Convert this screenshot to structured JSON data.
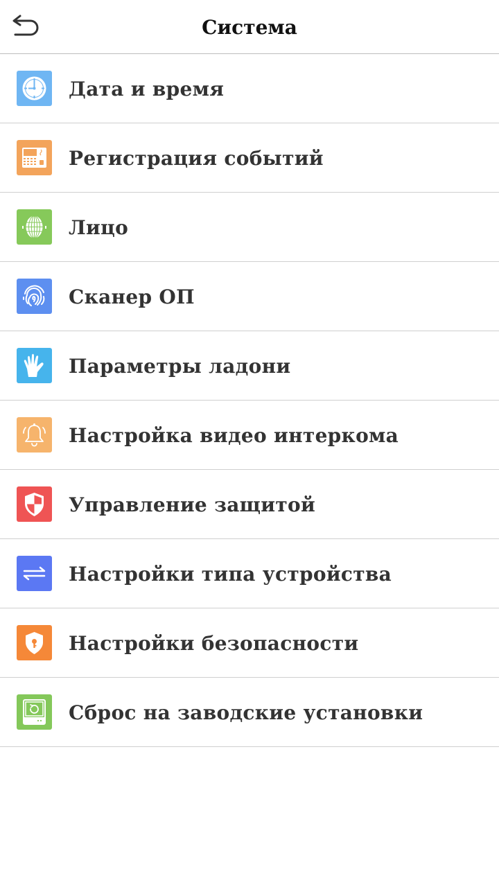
{
  "header": {
    "title": "Система",
    "back_icon": "back-arrow-icon"
  },
  "menu": {
    "items": [
      {
        "label": "Дата и время",
        "icon": "clock-icon",
        "color": "#6fb6f3"
      },
      {
        "label": "Регистрация событий",
        "icon": "terminal-icon",
        "color": "#f3a45b"
      },
      {
        "label": "Лицо",
        "icon": "face-scan-icon",
        "color": "#86c95a"
      },
      {
        "label": "Сканер ОП",
        "icon": "fingerprint-icon",
        "color": "#5d8ff0"
      },
      {
        "label": "Параметры ладони",
        "icon": "palm-icon",
        "color": "#46b4ec"
      },
      {
        "label": "Настройка видео интеркома",
        "icon": "bell-icon",
        "color": "#f6b46c"
      },
      {
        "label": "Управление защитой",
        "icon": "shield-icon",
        "color": "#ef5454"
      },
      {
        "label": "Настройки типа устройства",
        "icon": "swap-arrows-icon",
        "color": "#5b78f3"
      },
      {
        "label": "Настройки безопасности",
        "icon": "security-lock-icon",
        "color": "#f58838"
      },
      {
        "label": "Сброс на заводские установки",
        "icon": "factory-reset-icon",
        "color": "#84c85a"
      }
    ]
  }
}
